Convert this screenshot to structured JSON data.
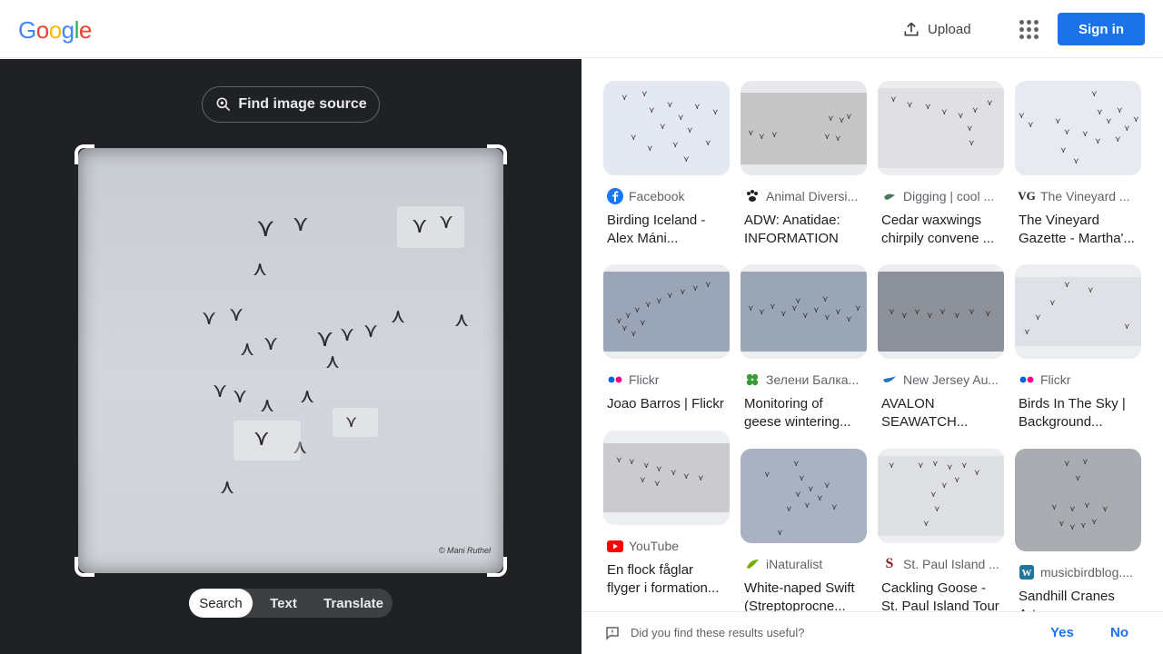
{
  "header": {
    "logo": [
      "G",
      "o",
      "o",
      "g",
      "l",
      "e"
    ],
    "logo_colors": [
      "#4285F4",
      "#EA4335",
      "#FBBC05",
      "#4285F4",
      "#34A853",
      "#EA4335"
    ],
    "upload_label": "Upload",
    "signin_label": "Sign in"
  },
  "left": {
    "find_source_label": "Find image source",
    "watermark": "© Mani Ruthel",
    "tabs": [
      {
        "label": "Search",
        "active": true
      },
      {
        "label": "Text",
        "active": false
      },
      {
        "label": "Translate",
        "active": false
      }
    ]
  },
  "results": [
    {
      "source": "Facebook",
      "icon": "facebook-icon",
      "title": "Birding Iceland - Alex Máni..."
    },
    {
      "source": "Animal Diversi...",
      "icon": "paw-icon",
      "title": "ADW: Anatidae: INFORMATION"
    },
    {
      "source": "Digging | cool ...",
      "icon": "bird-site-icon",
      "title": "Cedar waxwings chirpily convene ..."
    },
    {
      "source": "The Vineyard ...",
      "icon": "vg-icon",
      "title": "The Vineyard Gazette - Martha'..."
    },
    {
      "source": "Flickr",
      "icon": "flickr-icon",
      "title": "Joao Barros | Flickr"
    },
    {
      "source": "Зелени Балка...",
      "icon": "clover-icon",
      "title": "Monitoring of geese wintering..."
    },
    {
      "source": "New Jersey Au...",
      "icon": "bird-site-icon",
      "title": "AVALON SEAWATCH..."
    },
    {
      "source": "Flickr",
      "icon": "flickr-icon",
      "title": "Birds In The Sky | Background..."
    },
    {
      "source": "YouTube",
      "icon": "youtube-icon",
      "title": "En flock fåglar flyger i formation..."
    },
    {
      "source": "iNaturalist",
      "icon": "inaturalist-icon",
      "title": "White-naped Swift (Streptoprocne..."
    },
    {
      "source": "St. Paul Island ...",
      "icon": "s-logo-icon",
      "title": "Cackling Goose - St. Paul Island Tour"
    },
    {
      "source": "musicbirdblog....",
      "icon": "wordpress-icon",
      "title": "Sandhill Cranes Art..."
    }
  ],
  "feedback": {
    "question": "Did you find these results useful?",
    "yes": "Yes",
    "no": "No"
  }
}
